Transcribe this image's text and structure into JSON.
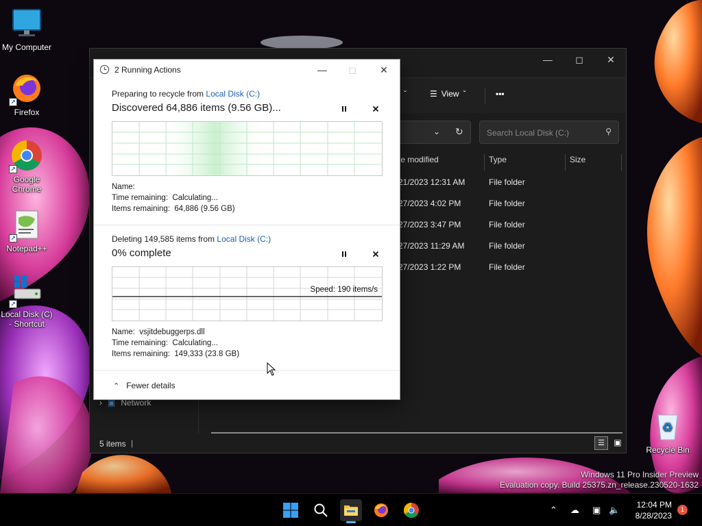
{
  "desktop": {
    "icons": [
      {
        "label": "My Computer"
      },
      {
        "label": "Firefox"
      },
      {
        "label": "Google Chrome"
      },
      {
        "label": "Notepad++"
      },
      {
        "label": "Local Disk (C) - Shortcut"
      },
      {
        "label": "Recycle Bin"
      }
    ],
    "watermark": {
      "line1": "Windows 11 Pro Insider Preview",
      "line2": "Evaluation copy. Build 25375.zn_release.230520-1632"
    }
  },
  "explorer": {
    "toolbar": {
      "view_label": "View",
      "more_label": "•••"
    },
    "search_placeholder": "Search Local Disk (C:)",
    "columns": [
      "te modified",
      "Type",
      "Size"
    ],
    "rows": [
      {
        "modified": "21/2023 12:31 AM",
        "type": "File folder"
      },
      {
        "modified": "27/2023 4:02 PM",
        "type": "File folder"
      },
      {
        "modified": "27/2023 3:47 PM",
        "type": "File folder"
      },
      {
        "modified": "27/2023 11:29 AM",
        "type": "File folder"
      },
      {
        "modified": "27/2023 1:22 PM",
        "type": "File folder"
      }
    ],
    "nav_network": "Network",
    "status_items": "5 items"
  },
  "dialog": {
    "title": "2 Running Actions",
    "op1": {
      "prefix": "Preparing to recycle from ",
      "location": "Local Disk (C:)",
      "headline": "Discovered 64,886 items (9.56 GB)...",
      "name_label": "Name:",
      "name_value": "",
      "time_label": "Time remaining:",
      "time_value": "Calculating...",
      "items_label": "Items remaining:",
      "items_value": "64,886 (9.56 GB)"
    },
    "op2": {
      "prefix": "Deleting 149,585 items from ",
      "location": "Local Disk (C:)",
      "headline": "0% complete",
      "progress_percent": 0,
      "speed": "Speed: 190 items/s",
      "name_label": "Name:",
      "name_value": "vsjitdebuggerps.dll",
      "time_label": "Time remaining:",
      "time_value": "Calculating...",
      "items_label": "Items remaining:",
      "items_value": "149,333 (23.8 GB)"
    },
    "fewer_details": "Fewer details"
  },
  "taskbar": {
    "time": "12:04 PM",
    "date": "8/28/2023",
    "notification_count": "1"
  },
  "colors": {
    "link": "#1a5fb4",
    "taskbar": "#000000",
    "explorer_bg": "#1c1c1c"
  }
}
